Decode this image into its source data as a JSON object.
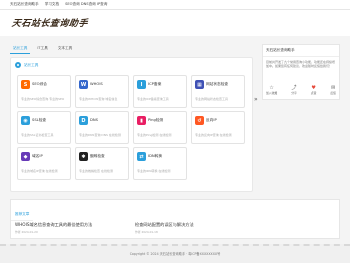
{
  "topbar": {
    "links": [
      "天石站长查询助手",
      "学习文档",
      "SEO查询 DNS查询 IP查询"
    ]
  },
  "header": {
    "logo_text": "天石站长查询助手"
  },
  "tabs": [
    "站长工具",
    "IT工具",
    "文本工具"
  ],
  "tools_section": {
    "title": "站长工具",
    "items": [
      {
        "name": "SEO综合",
        "desc": "专业的SEO综合查询·专业的SEO",
        "icon": "seo-icon",
        "color": "#ff6a00"
      },
      {
        "name": "WHOIS",
        "desc": "专业的WHOIS查询 域名信息",
        "icon": "whois-icon",
        "color": "#3366cc"
      },
      {
        "name": "ICP备案",
        "desc": "专业的ICP备案查询工具",
        "icon": "icp-icon",
        "color": "#2b9fdb"
      },
      {
        "name": "网站状态检查",
        "desc": "专业的网站状态检查工具",
        "icon": "status-icon",
        "color": "#3f51b5"
      },
      {
        "name": "SSL检查",
        "desc": "专业的SSL证书检查工具",
        "icon": "ssl-icon",
        "color": "#2b9fdb"
      },
      {
        "name": "DNS",
        "desc": "专业的DNS查询 DNS 在线检测",
        "icon": "dns-icon",
        "color": "#2b9fdb"
      },
      {
        "name": "Ping检测",
        "desc": "专业的Ping检测 在线检测",
        "icon": "ping-icon",
        "color": "#e91e63"
      },
      {
        "name": "反向IP",
        "desc": "专业的反向IP查询 在线检测",
        "icon": "reverse-ip-icon",
        "color": "#ff5722"
      },
      {
        "name": "域名IP",
        "desc": "专业的域名IP查询 在线检测",
        "icon": "domain-ip-icon",
        "color": "#673ab7"
      },
      {
        "name": "蜘蛛检查",
        "desc": "专业的蜘蛛检查 在线检测",
        "icon": "spider-icon",
        "color": "#212121"
      },
      {
        "name": "IDN转换",
        "desc": "专业的IDN转换 在线检测",
        "icon": "idn-icon",
        "color": "#2b9fdb"
      }
    ]
  },
  "sidebar": {
    "title": "天石站长查询助手",
    "desc": "目前共开发了九个常用查询小功能，功能还在持续增加中。如果您有任何建议，欢迎随时反馈给我们！",
    "actions": [
      {
        "label": "加入收藏",
        "icon": "star-icon"
      },
      {
        "label": "分享",
        "icon": "share-icon"
      },
      {
        "label": "点赞",
        "icon": "heart-icon"
      },
      {
        "label": "反馈",
        "icon": "feedback-icon"
      }
    ]
  },
  "articles": {
    "heading": "推荐文章",
    "items": [
      {
        "title": "WHOIS域名信息查询工具的最佳使用方法",
        "meta": "作者 2024-01-20"
      },
      {
        "title": "检查网站配置的误区与解决方法",
        "meta": "作者 2024-01-18"
      }
    ]
  },
  "footer": {
    "text": "Copyright © 2024 天石站长查询助手 · 粤ICP备XXXXXXXX号"
  }
}
